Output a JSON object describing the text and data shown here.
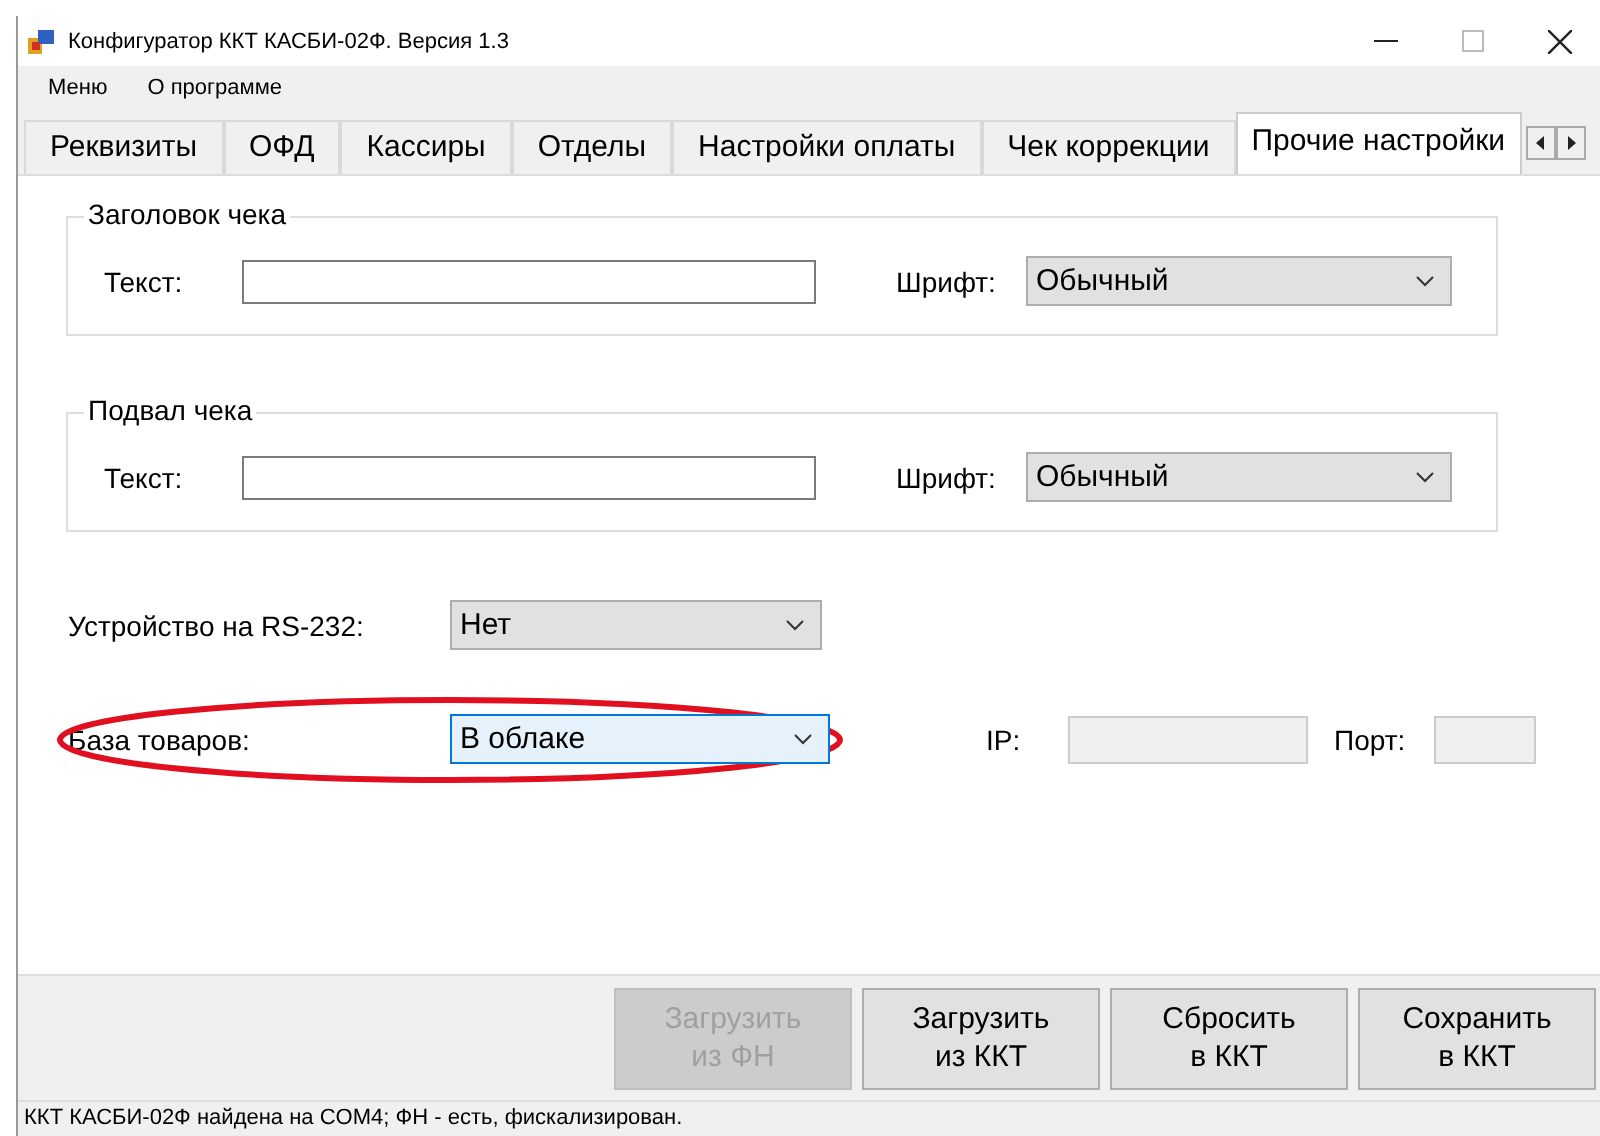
{
  "window": {
    "title": "Конфигуратор ККТ КАСБИ-02Ф. Версия 1.3"
  },
  "menu": [
    "Меню",
    "О программе"
  ],
  "tabs": [
    {
      "label": "Реквизиты",
      "selected": false
    },
    {
      "label": "ОФД",
      "selected": false
    },
    {
      "label": "Кассиры",
      "selected": false
    },
    {
      "label": "Отделы",
      "selected": false
    },
    {
      "label": "Настройки оплаты",
      "selected": false
    },
    {
      "label": "Чек коррекции",
      "selected": false
    },
    {
      "label": "Прочие настройки",
      "selected": true
    }
  ],
  "groups": [
    {
      "title": "Заголовок чека",
      "text_label": "Текст:",
      "font_label": "Шрифт:",
      "font_value": "Обычный"
    },
    {
      "title": "Подвал чека",
      "text_label": "Текст:",
      "font_label": "Шрифт:",
      "font_value": "Обычный"
    }
  ],
  "rs232": {
    "label": "Устройство на RS-232:",
    "value": "Нет",
    "focused": false
  },
  "goods_base": {
    "label": "База товаров:",
    "value": "В облаке",
    "focused": true,
    "circled": true
  },
  "ip": {
    "label": "IP:",
    "disabled": true
  },
  "port": {
    "label": "Порт:",
    "disabled": true
  },
  "buttons": [
    {
      "label": "Загрузить\nиз ФН",
      "disabled": true
    },
    {
      "label": "Загрузить\nиз ККТ",
      "disabled": false
    },
    {
      "label": "Сбросить\nв ККТ",
      "disabled": false
    },
    {
      "label": "Сохранить\nв ККТ",
      "disabled": false
    }
  ],
  "status_bar": "ККТ КАСБИ-02Ф найдена на COM4; ФН - есть, фискализирован."
}
